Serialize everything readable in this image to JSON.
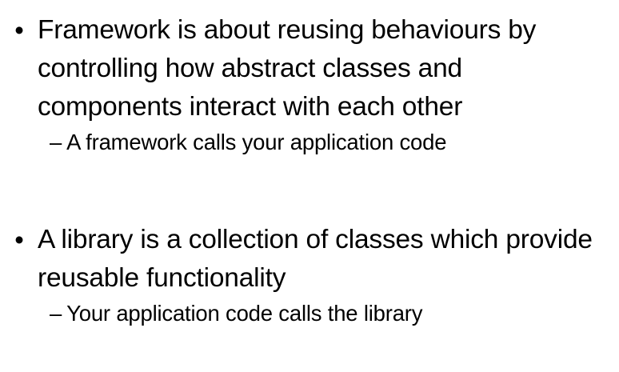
{
  "bullets": [
    {
      "marker": "•",
      "text": "Framework is about reusing behaviours by controlling how abstract classes and components interact with each other",
      "sub": {
        "marker": "–",
        "text": "A framework calls your application code"
      }
    },
    {
      "marker": "•",
      "text": "A library is a collection of classes which provide reusable functionality",
      "sub": {
        "marker": "–",
        "text": "Your application code calls the library"
      }
    }
  ]
}
